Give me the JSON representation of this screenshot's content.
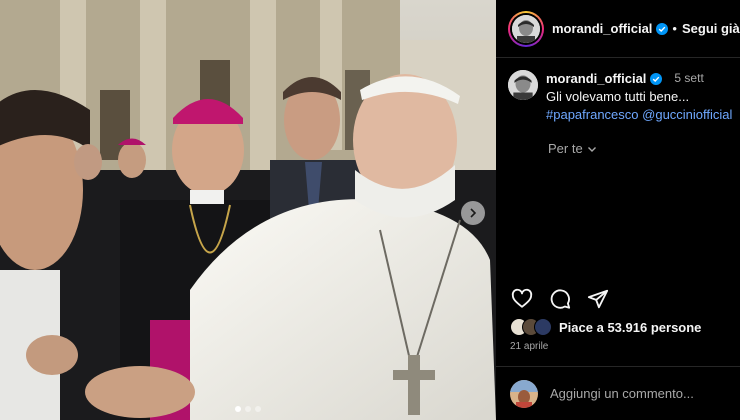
{
  "header": {
    "username": "morandi_official",
    "separator": "•",
    "follow_label": "Segui già"
  },
  "caption": {
    "username": "morandi_official",
    "time": "5 sett",
    "text": "Gli volevamo tutti bene...",
    "hashtags": [
      "#papafrancesco",
      "@gucciniofficial"
    ]
  },
  "for_you": {
    "label": "Per te"
  },
  "likes": {
    "label": "Piace a",
    "count": "53.916",
    "suffix": "persone"
  },
  "date": "21 aprile",
  "comment": {
    "placeholder": "Aggiungi un commento..."
  },
  "carousel": {
    "slide_count": 3,
    "active_index": 0
  },
  "icons": {
    "verified": "verified-badge-icon",
    "chevron": "chevron-down-icon",
    "like": "heart-icon",
    "comment": "comment-icon",
    "share": "share-icon",
    "next": "chevron-right-icon"
  },
  "colors": {
    "accent_link": "#6fa8ff",
    "verified": "#0095f6",
    "text_primary": "#f5f5f5",
    "text_secondary": "#a8a8a8"
  }
}
